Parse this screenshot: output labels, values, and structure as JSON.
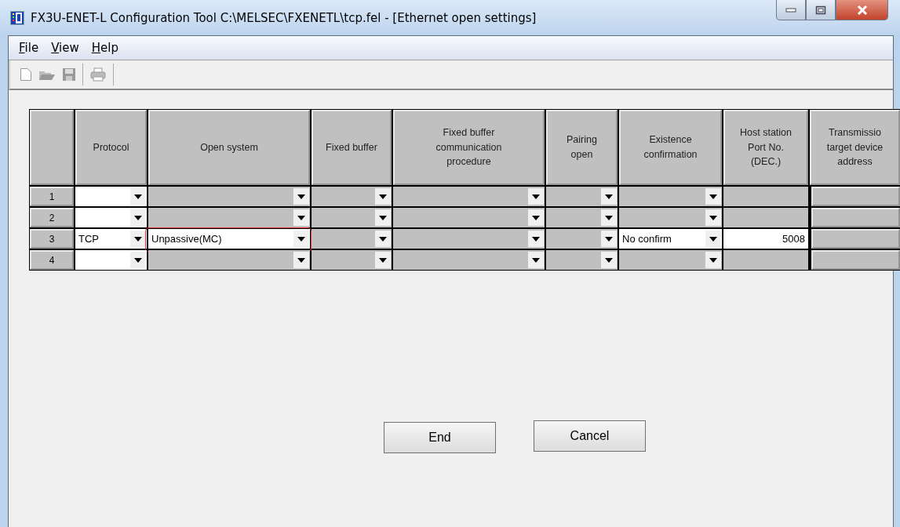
{
  "window": {
    "title": "FX3U-ENET-L Configuration Tool C:\\MELSEC\\FXENETL\\tcp.fel - [Ethernet open settings]"
  },
  "menu": [
    {
      "label": "File"
    },
    {
      "label": "View"
    },
    {
      "label": "Help"
    }
  ],
  "table": {
    "columns": [
      {},
      {
        "label": "Protocol"
      },
      {
        "label": "Open system"
      },
      {
        "label": "Fixed buffer"
      },
      {
        "label": "Fixed buffer communication procedure"
      },
      {
        "label": "Pairing open"
      },
      {
        "label": "Existence confirmation"
      },
      {
        "label": "Host station Port No. (DEC.)"
      },
      {
        "label": "Transmissio target device address"
      }
    ],
    "rows": [
      {
        "cells": [
          {
            "kind": "number",
            "value": "1"
          },
          {
            "kind": "dropdown",
            "editable": true
          },
          {
            "kind": "dropdown",
            "editable": false
          },
          {
            "kind": "dropdown",
            "editable": false
          },
          {
            "kind": "dropdown",
            "editable": false
          },
          {
            "kind": "dropdown",
            "editable": false
          },
          {
            "kind": "dropdown",
            "editable": false
          },
          {
            "kind": "input",
            "editable": false
          },
          {
            "kind": "button",
            "editable": false
          }
        ]
      },
      {
        "cells": [
          {
            "kind": "number",
            "value": "2"
          },
          {
            "kind": "dropdown",
            "editable": true
          },
          {
            "kind": "dropdown",
            "editable": false
          },
          {
            "kind": "dropdown",
            "editable": false
          },
          {
            "kind": "dropdown",
            "editable": false
          },
          {
            "kind": "dropdown",
            "editable": false
          },
          {
            "kind": "dropdown",
            "editable": false
          },
          {
            "kind": "input",
            "editable": false
          },
          {
            "kind": "button",
            "editable": false
          }
        ]
      },
      {
        "cells": [
          {
            "kind": "number",
            "value": "3"
          },
          {
            "kind": "dropdown",
            "editable": true,
            "value": "TCP"
          },
          {
            "kind": "dropdown",
            "editable": true,
            "value": "Unpassive(MC)",
            "highlighted": true
          },
          {
            "kind": "dropdown",
            "editable": false
          },
          {
            "kind": "dropdown",
            "editable": false
          },
          {
            "kind": "dropdown",
            "editable": false
          },
          {
            "kind": "dropdown",
            "editable": true,
            "value": "No confirm"
          },
          {
            "kind": "input",
            "editable": true,
            "value": "5008"
          },
          {
            "kind": "button",
            "editable": false
          }
        ]
      },
      {
        "cells": [
          {
            "kind": "number",
            "value": "4"
          },
          {
            "kind": "dropdown",
            "editable": true
          },
          {
            "kind": "dropdown",
            "editable": false
          },
          {
            "kind": "dropdown",
            "editable": false
          },
          {
            "kind": "dropdown",
            "editable": false
          },
          {
            "kind": "dropdown",
            "editable": false
          },
          {
            "kind": "dropdown",
            "editable": false
          },
          {
            "kind": "input",
            "editable": false
          },
          {
            "kind": "button",
            "editable": false
          }
        ]
      }
    ]
  },
  "buttons": [
    {
      "label": "End"
    },
    {
      "label": "Cancel"
    }
  ]
}
